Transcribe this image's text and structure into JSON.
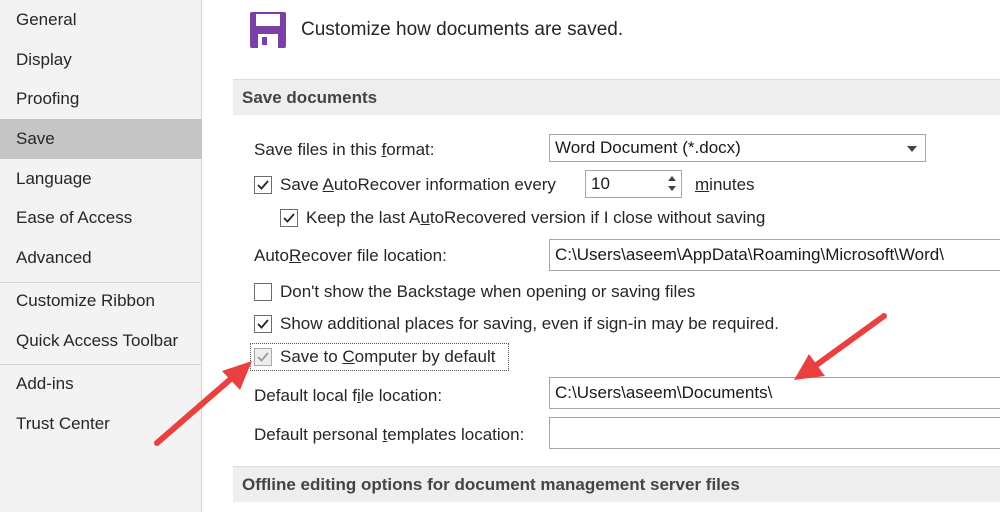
{
  "sidebar": {
    "items": [
      {
        "label": "General"
      },
      {
        "label": "Display"
      },
      {
        "label": "Proofing"
      },
      {
        "label": "Save"
      },
      {
        "label": "Language"
      },
      {
        "label": "Ease of Access"
      },
      {
        "label": "Advanced"
      },
      {
        "label": "Customize Ribbon"
      },
      {
        "label": "Quick Access Toolbar"
      },
      {
        "label": "Add-ins"
      },
      {
        "label": "Trust Center"
      }
    ],
    "selected": "Save"
  },
  "header": {
    "icon": "floppy-disk-icon",
    "text": "Customize how documents are saved."
  },
  "sections": {
    "save_documents": "Save documents",
    "offline_editing": "Offline editing options for document management server files"
  },
  "form": {
    "format": {
      "label_pre": "Save files in this ",
      "label_ul": "f",
      "label_post": "ormat:",
      "value": "Word Document (*.docx)"
    },
    "autorecover": {
      "checked": true,
      "label_pre": "Save ",
      "label_ul": "A",
      "label_post": "utoRecover information every",
      "minutes_value": "10",
      "unit_ul": "m",
      "unit_post": "inutes"
    },
    "keep_last": {
      "checked": true,
      "label_pre": "Keep the last A",
      "label_ul": "u",
      "label_post": "toRecovered version if I close without saving"
    },
    "autorecover_location": {
      "label_pre": "Auto",
      "label_ul": "R",
      "label_post": "ecover file location:",
      "value": "C:\\Users\\aseem\\AppData\\Roaming\\Microsoft\\Word\\"
    },
    "backstage": {
      "checked": false,
      "label": "Don't show the Backstage when opening or saving files"
    },
    "additional_places": {
      "checked": true,
      "label": "Show additional places for saving, even if sign-in may be required."
    },
    "save_to_computer": {
      "checked": true,
      "disabled": true,
      "label_pre": "Save to ",
      "label_ul": "C",
      "label_post": "omputer by default"
    },
    "default_local": {
      "label_pre": "Default local f",
      "label_ul": "i",
      "label_post": "le location:",
      "value": "C:\\Users\\aseem\\Documents\\"
    },
    "default_templates": {
      "label_pre": "Default personal ",
      "label_ul": "t",
      "label_post": "emplates location:",
      "value": ""
    }
  },
  "annotation": {
    "arrow_color": "#e8413f"
  }
}
